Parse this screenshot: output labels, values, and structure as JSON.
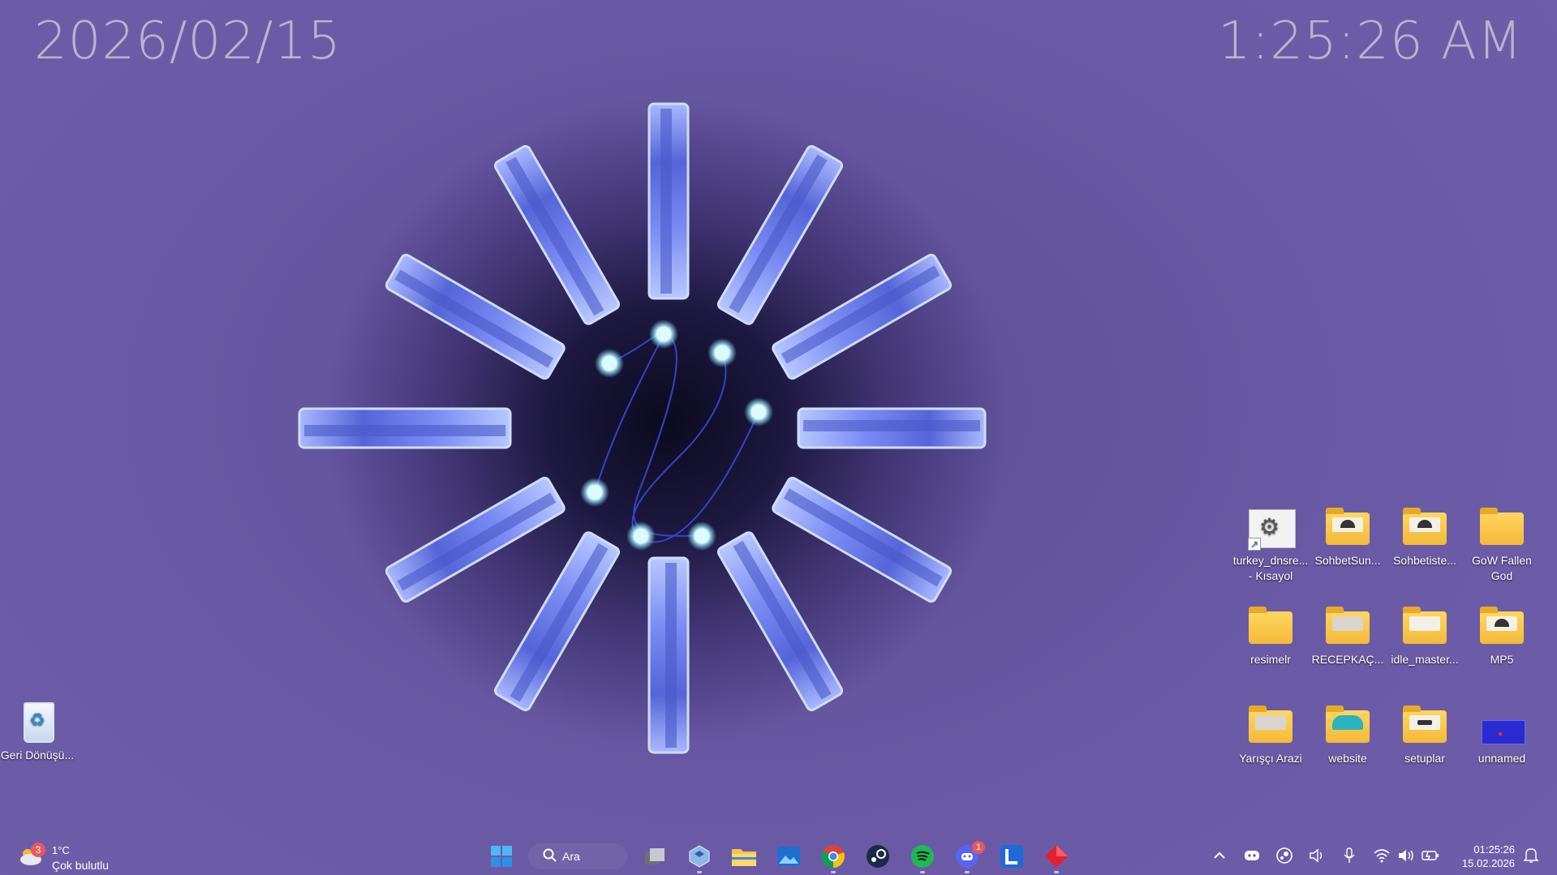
{
  "wallpaper": {
    "date": "2026/02/15",
    "time": "1:25:26 AM"
  },
  "desktop_icons": [
    {
      "label": "turkey_dnsre... - Kısayol",
      "icon": "settings-shortcut-icon"
    },
    {
      "label": "SohbetSun...",
      "icon": "folder-icon"
    },
    {
      "label": "Sohbetiste...",
      "icon": "folder-icon"
    },
    {
      "label": "GoW Fallen God",
      "icon": "folder-icon"
    },
    {
      "label": "resimelr",
      "icon": "folder-icon"
    },
    {
      "label": "RECEPKAÇ...",
      "icon": "folder-icon"
    },
    {
      "label": "idle_master...",
      "icon": "folder-icon"
    },
    {
      "label": "MP5",
      "icon": "folder-icon"
    },
    {
      "label": "Yarışçı Arazi",
      "icon": "folder-icon"
    },
    {
      "label": "website",
      "icon": "folder-icon"
    },
    {
      "label": "setuplar",
      "icon": "folder-icon"
    },
    {
      "label": "unnamed",
      "icon": "image-icon"
    }
  ],
  "recycle_bin": {
    "label": "Geri Dönüşü...",
    "icon": "recycle-bin-icon"
  },
  "taskbar": {
    "weather": {
      "temp": "1°C",
      "condition": "Çok bulutlu",
      "badge": "3"
    },
    "search_label": "Ara",
    "apps": [
      {
        "name": "start",
        "icon": "windows-logo-icon"
      },
      {
        "name": "task-view",
        "icon": "task-view-icon"
      },
      {
        "name": "app-cube",
        "icon": "cube-app-icon"
      },
      {
        "name": "file-explorer",
        "icon": "folder-icon"
      },
      {
        "name": "photos",
        "icon": "photos-icon"
      },
      {
        "name": "chrome",
        "icon": "chrome-icon"
      },
      {
        "name": "steam",
        "icon": "steam-icon"
      },
      {
        "name": "spotify",
        "icon": "spotify-icon"
      },
      {
        "name": "discord",
        "icon": "discord-icon",
        "badge": "1"
      },
      {
        "name": "app-l",
        "icon": "l-app-icon"
      },
      {
        "name": "app-red",
        "icon": "red-diamond-icon"
      }
    ],
    "tray": {
      "time": "01:25:26",
      "date": "15.02.2026"
    }
  },
  "colors": {
    "wallpaper_purple": "#6a5aa6",
    "crystal_blue": "#6f80f0",
    "folder_yellow": "#f7c948"
  }
}
